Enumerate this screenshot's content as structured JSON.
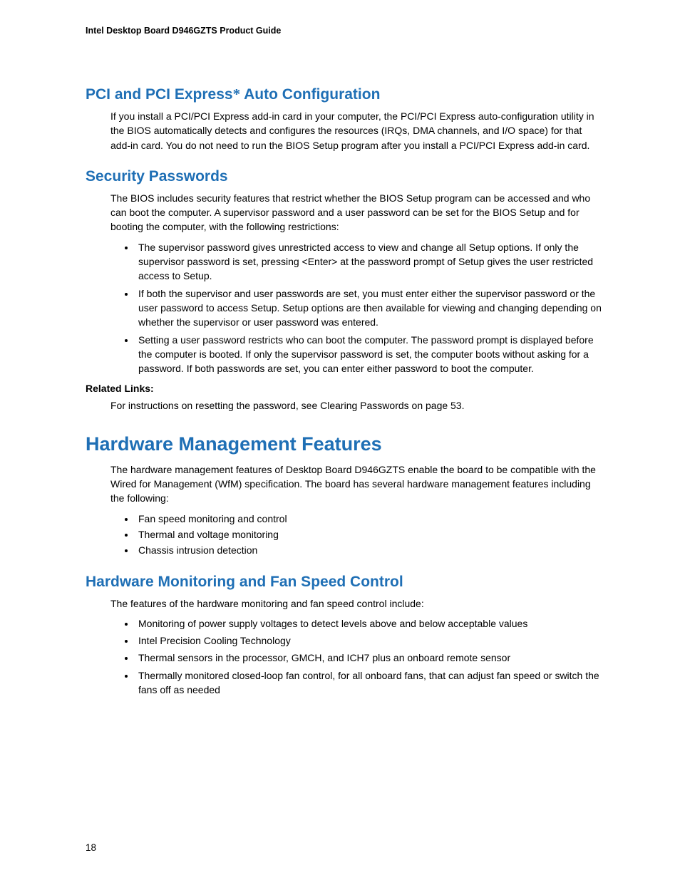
{
  "header": "Intel Desktop Board D946GZTS Product Guide",
  "sections": {
    "pci": {
      "title_pre": "PCI and PCI Express",
      "title_post": " Auto Configuration",
      "para": "If you install a PCI/PCI Express add-in card in your computer, the PCI/PCI Express auto-configuration utility in the BIOS automatically detects and configures the resources (IRQs, DMA channels, and I/O space) for that add-in card.  You do not need to run the BIOS Setup program after you install a PCI/PCI Express add-in card."
    },
    "security": {
      "title": "Security Passwords",
      "para": "The BIOS includes security features that restrict whether the BIOS Setup program can be accessed and who can boot the computer.  A supervisor password and a user password can be set for the BIOS Setup and for booting the computer, with the following restrictions:",
      "bullets": [
        "The supervisor password gives unrestricted access to view and change all Setup options.  If only the supervisor password is set, pressing <Enter> at the password prompt of Setup gives the user restricted access to Setup.",
        "If both the supervisor and user passwords are set, you must enter either the supervisor password or the user password to access Setup.  Setup options are then available for viewing and changing depending on whether the supervisor or user password was entered.",
        "Setting a user password restricts who can boot the computer.  The password prompt is displayed before the computer is booted.  If only the supervisor password is set, the computer boots without asking for a password.  If both passwords are set, you can enter either password to boot the computer."
      ],
      "related_label": "Related Links:",
      "related_text": "For instructions on resetting the password, see Clearing Passwords on page 53."
    },
    "hw_mgmt": {
      "title": "Hardware Management Features",
      "para": "The hardware management features of Desktop Board D946GZTS enable the board to be compatible with the Wired for Management (WfM) specification.  The board has several hardware management features including the following:",
      "bullets": [
        "Fan speed monitoring and control",
        "Thermal and voltage monitoring",
        "Chassis intrusion detection"
      ]
    },
    "hw_mon": {
      "title": "Hardware Monitoring and Fan Speed Control",
      "para": "The features of the hardware monitoring and fan speed control include:",
      "bullets": [
        "Monitoring of power supply voltages to detect levels above and below acceptable values",
        "Intel Precision Cooling Technology",
        "Thermal sensors in the processor, GMCH, and ICH7 plus an onboard remote sensor",
        "Thermally monitored closed-loop fan control, for all onboard fans, that can adjust fan speed or switch the fans off as needed"
      ]
    }
  },
  "page_number": "18"
}
